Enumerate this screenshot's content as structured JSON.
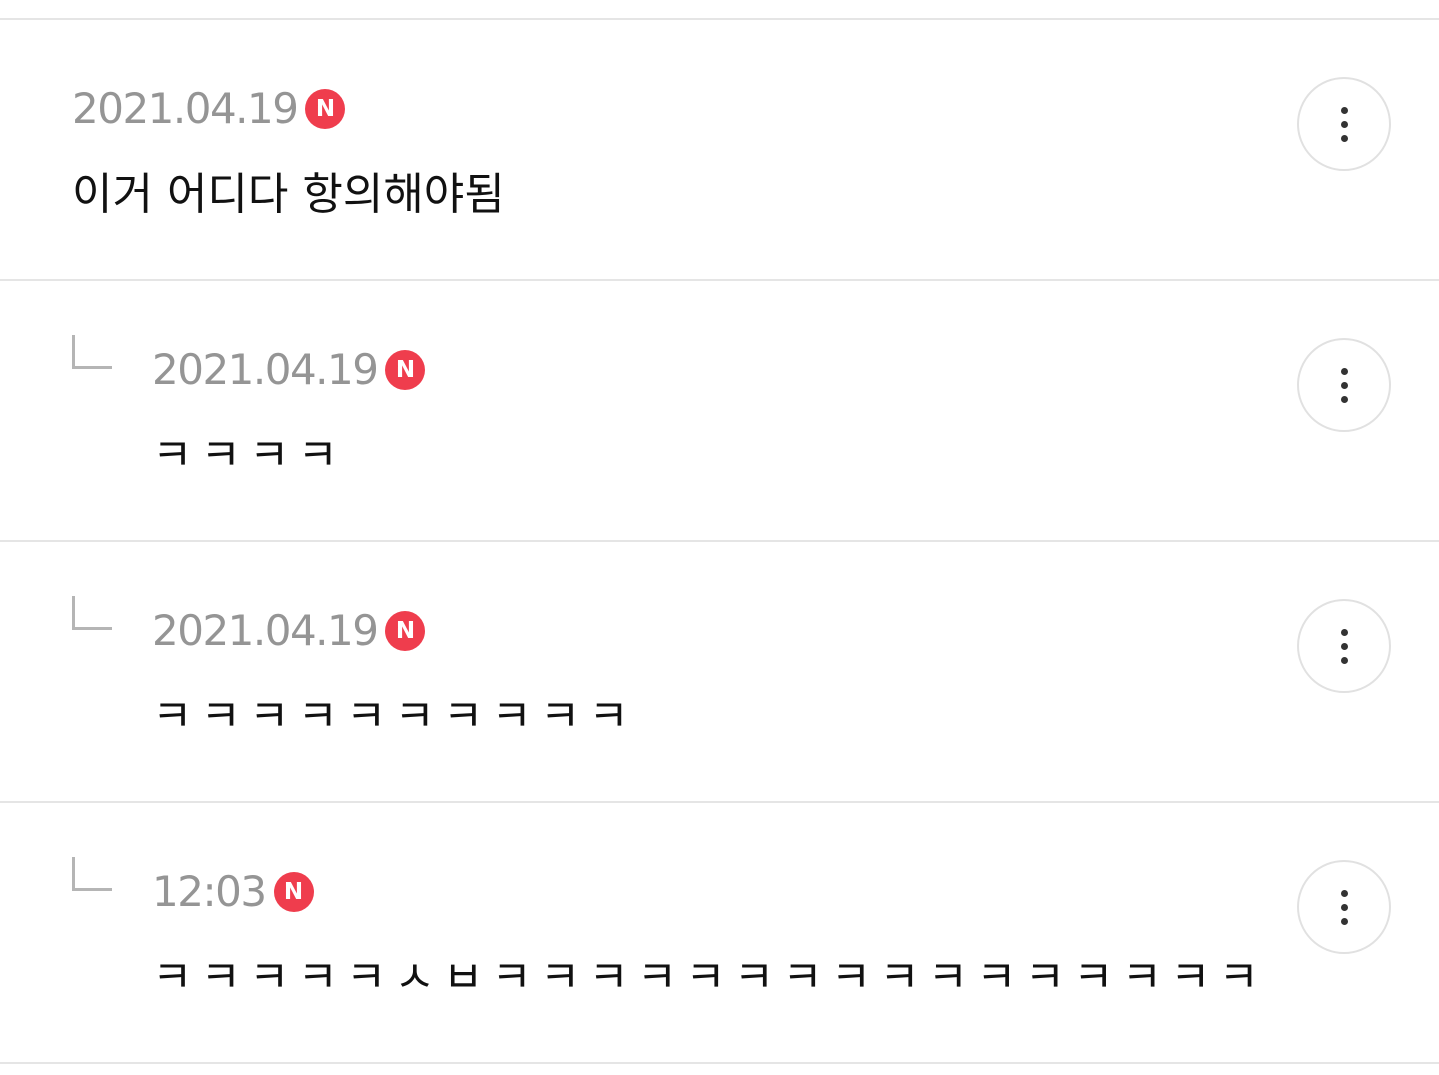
{
  "comments": [
    {
      "date": "2021.04.19",
      "badge": "N",
      "text": "이거 어디다 항의해야됨",
      "reply": false
    },
    {
      "date": "2021.04.19",
      "badge": "N",
      "text": "ㅋㅋㅋㅋ",
      "reply": true
    },
    {
      "date": "2021.04.19",
      "badge": "N",
      "text": "ㅋㅋㅋㅋㅋㅋㅋㅋㅋㅋ",
      "reply": true
    },
    {
      "date": "12:03",
      "badge": "N",
      "text": "ㅋㅋㅋㅋㅋㅅㅂㅋㅋㅋㅋㅋㅋㅋㅋㅋㅋㅋㅋㅋㅋㅋㅋ",
      "reply": true
    }
  ],
  "icons": {
    "more": "more-vertical-icon",
    "reply": "reply-arrow-icon"
  },
  "colors": {
    "badge": "#ef3d4d",
    "date": "#959595",
    "divider": "#e5e5e5"
  }
}
